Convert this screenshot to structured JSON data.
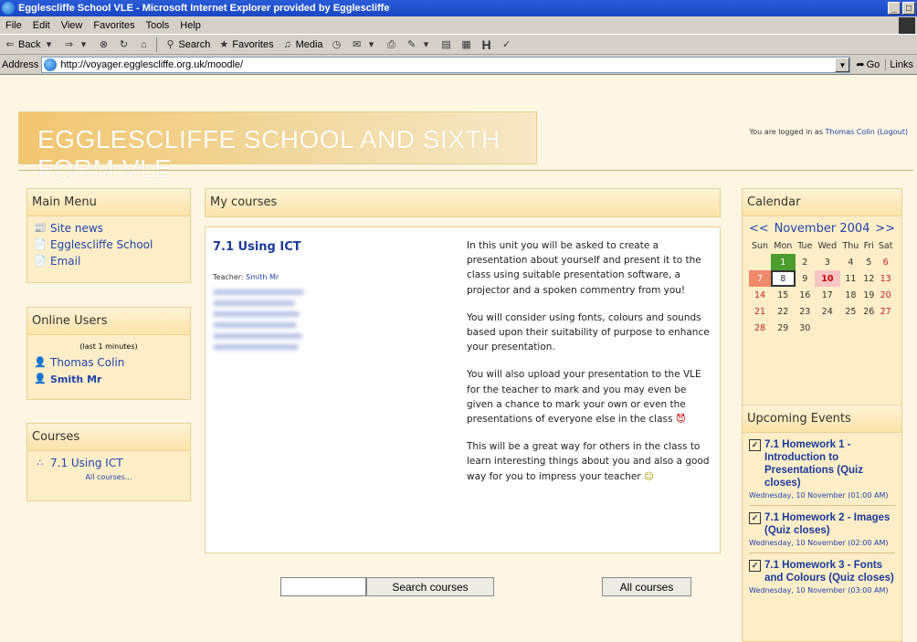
{
  "window": {
    "title": "Egglescliffe School VLE - Microsoft Internet Explorer provided by Egglescliffe",
    "controls": [
      "_",
      "&#9633;"
    ]
  },
  "menubar": [
    "File",
    "Edit",
    "View",
    "Favorites",
    "Tools",
    "Help"
  ],
  "toolbar": {
    "back": "Back",
    "search": "Search",
    "favorites": "Favorites",
    "media": "Media"
  },
  "address": {
    "label": "Address",
    "url": "http://voyager.egglescliffe.org.uk/moodle/",
    "go": "Go",
    "links": "Links"
  },
  "header": {
    "banner": "EGGLESCLIFFE SCHOOL AND SIXTH FORM VLE",
    "logged_in_prefix": "You are logged in as",
    "user": "Thomas Colin",
    "logout": "(Logout)"
  },
  "main_menu": {
    "title": "Main Menu",
    "items": [
      "Site news",
      "Egglescliffe School",
      "Email"
    ]
  },
  "online_users": {
    "title": "Online Users",
    "note": "(last 1 minutes)",
    "users": [
      "Thomas Colin",
      "Smith Mr"
    ]
  },
  "courses": {
    "title": "Courses",
    "item": "7.1 Using ICT",
    "all": "All courses..."
  },
  "my_courses": {
    "title": "My courses",
    "course_title": "7.1 Using ICT",
    "teacher_label": "Teacher:",
    "teacher_name": "Smith Mr",
    "summary": [
      "In this unit you will be asked to create a presentation about yourself and present it to the class using suitable presentation software, a projector and a spoken commentry from you!",
      "You will consider using fonts, colours and sounds based upon their suitability of purpose to enhance your presentation.",
      "You will also upload your presentation to the VLE for the teacher to mark and you may even be given a chance to mark your own or even the presentations of everyone else in the class",
      "This will be a great way for others in the class to learn interesting things about you and also a good way for you to impress your teacher"
    ],
    "search_button": "Search courses",
    "all_courses_button": "All courses"
  },
  "calendar": {
    "title": "Calendar",
    "prev": "<<",
    "month": "November 2004",
    "next": ">>",
    "days": [
      "Sun",
      "Mon",
      "Tue",
      "Wed",
      "Thu",
      "Fri",
      "Sat"
    ],
    "weeks": [
      [
        "",
        "1",
        "2",
        "3",
        "4",
        "5",
        "6"
      ],
      [
        "7",
        "8",
        "9",
        "10",
        "11",
        "12",
        "13"
      ],
      [
        "14",
        "15",
        "16",
        "17",
        "18",
        "19",
        "20"
      ],
      [
        "21",
        "22",
        "23",
        "24",
        "25",
        "26",
        "27"
      ],
      [
        "28",
        "29",
        "30",
        "",
        "",
        "",
        ""
      ]
    ]
  },
  "upcoming": {
    "title": "Upcoming Events",
    "events": [
      {
        "title": "7.1 Homework 1 - Introduction to Presentations (Quiz closes)",
        "date": "Wednesday, 10 November (01:00 AM)"
      },
      {
        "title": "7.1 Homework 2 - Images (Quiz closes)",
        "date": "Wednesday, 10 November (02:00 AM)"
      },
      {
        "title": "7.1 Homework 3 - Fonts and Colours (Quiz closes)",
        "date": "Wednesday, 10 November (03:00 AM)"
      }
    ]
  }
}
